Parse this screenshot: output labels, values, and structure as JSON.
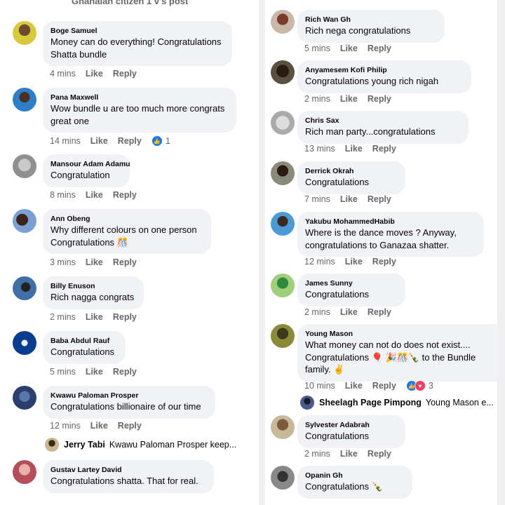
{
  "left": {
    "header_fragment": "Ghanaian citizen 1 v's post",
    "comments": [
      {
        "name": "Boge Samuel",
        "lines": [
          "Money can do everything! Congratulations",
          "Shatta bundle"
        ],
        "time": "4 mins"
      },
      {
        "name": "Pana Maxwell",
        "lines": [
          "Wow bundle u are too much more congrats",
          "great one"
        ],
        "time": "14 mins",
        "reactions": {
          "count": "1",
          "icons": [
            "like-reaction"
          ]
        }
      },
      {
        "name": "Mansour Adam Adamu",
        "lines": [
          "Congratulation"
        ],
        "time": "8 mins"
      },
      {
        "name": "Ann Obeng",
        "lines": [
          "Why different colours on one person",
          "Congratulations 🎊"
        ],
        "time": "3 mins"
      },
      {
        "name": "Billy Enuson",
        "lines": [
          "Rich nagga congrats"
        ],
        "time": "2 mins"
      },
      {
        "name": "Baba Abdul Rauf",
        "lines": [
          "Congratulations"
        ],
        "time": "5 mins"
      },
      {
        "name": "Kwawu Paloman Prosper",
        "lines": [
          "Congratulations billionaire of our time"
        ],
        "time": "12 mins"
      },
      {
        "name": "Gustav Lartey David",
        "lines": [
          "Congratulations shatta.  That for real."
        ],
        "time": ""
      }
    ],
    "reply_preview": {
      "name": "Jerry Tabi",
      "text": "Kwawu Paloman Prosper keep..."
    }
  },
  "right": {
    "comments": [
      {
        "name": "Rich Wan Gh",
        "lines": [
          "Rich nega congratulations"
        ],
        "time": "5 mins"
      },
      {
        "name": "Anyamesem Kofi Philip",
        "lines": [
          "Congratulations young rich nigah"
        ],
        "time": "2 mins"
      },
      {
        "name": "Chris Sax",
        "lines": [
          "Rich man party...congratulations"
        ],
        "time": "13 mins"
      },
      {
        "name": "Derrick Okrah",
        "lines": [
          "Congratulations"
        ],
        "time": "7 mins"
      },
      {
        "name": "Yakubu MohammedHabib",
        "lines": [
          "Where is the dance moves ? Anyway,",
          "congratulations to Ganazaa shatter."
        ],
        "time": "12 mins"
      },
      {
        "name": "James Sunny",
        "lines": [
          "Congratulations"
        ],
        "time": "2 mins"
      },
      {
        "name": "Young Mason",
        "lines": [
          "What money can not do does not exist....",
          "Congratulations 🎈 🎉🎊🍾  to the Bundle",
          "family. ✌"
        ],
        "time": "10 mins",
        "reactions": {
          "count": "3",
          "icons": [
            "like-reaction",
            "love-reaction"
          ]
        }
      },
      {
        "name": "Sylvester Adabrah",
        "lines": [
          "Congratulations"
        ],
        "time": "2 mins"
      },
      {
        "name": "Opanin Gh",
        "lines": [
          "Congratulations 🍾"
        ],
        "time": ""
      }
    ],
    "reply_preview": {
      "name": "Sheelagh Page Pimpong",
      "text": "Young Mason e..."
    }
  },
  "actions": {
    "like": "Like",
    "reply": "Reply"
  },
  "colors": {
    "like_blue": "#1877f2",
    "love_red": "#f33e58",
    "bubble": "#f0f2f5",
    "meta_gray": "#65676b"
  }
}
